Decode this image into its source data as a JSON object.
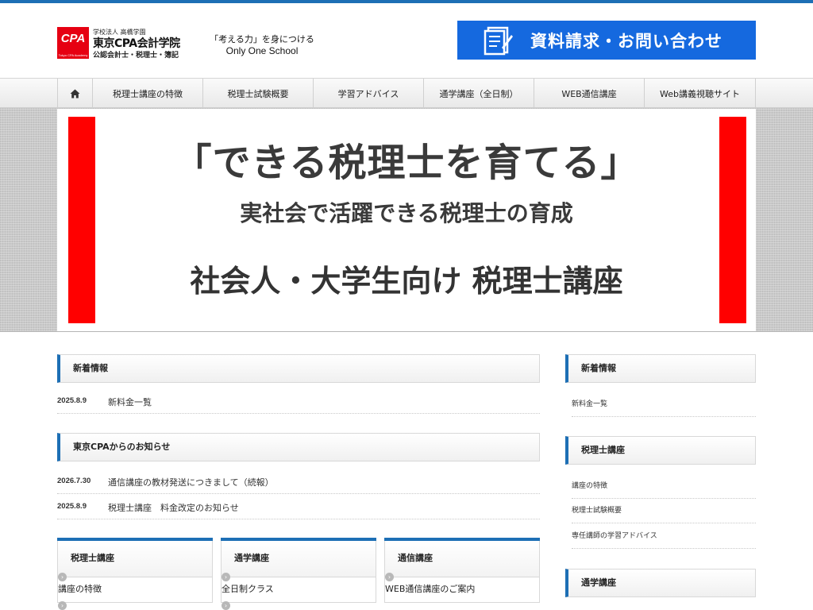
{
  "header": {
    "logo_mark": "CPA",
    "logo_mark_sub": "Tokyo CPA Academy",
    "logo_line1": "学校法人 高橋学園",
    "logo_line2": "東京CPA会計学院",
    "logo_line3": "公認会計士・税理士・簿記",
    "tagline_jp": "「考える力」を身につける",
    "tagline_en": "Only One School",
    "request_button": "資料請求・お問い合わせ"
  },
  "nav": {
    "home_icon": "home-icon",
    "items": [
      "税理士講座の特徴",
      "税理士試験概要",
      "学習アドバイス",
      "通学講座（全日制）",
      "WEB通信講座",
      "Web講義視聴サイト"
    ]
  },
  "hero": {
    "headline": "「できる税理士を育てる」",
    "subheadline": "実社会で活躍できる税理士の育成",
    "tagline": "社会人・大学生向け 税理士講座"
  },
  "main": {
    "news_heading": "新着情報",
    "news": [
      {
        "date": "2025.8.9",
        "title": "新料金一覧"
      }
    ],
    "notices_heading": "東京CPAからのお知らせ",
    "notices": [
      {
        "date": "2026.7.30",
        "title": "通信講座の教材発送につきまして（続報）"
      },
      {
        "date": "2025.8.9",
        "title": "税理士講座　料金改定のお知らせ"
      }
    ],
    "cards": [
      {
        "title": "税理士講座",
        "link": "講座の特徴"
      },
      {
        "title": "通学講座",
        "link": "全日制クラス"
      },
      {
        "title": "通信講座",
        "link": "WEB通信講座のご案内"
      }
    ]
  },
  "sidebar": {
    "news_heading": "新着情報",
    "news_links": [
      "新料金一覧"
    ],
    "course_heading": "税理士講座",
    "course_links": [
      "講座の特徴",
      "税理士試験概要",
      "専任講師の学習アドバイス"
    ],
    "commute_heading": "通学講座"
  },
  "colors": {
    "accent_blue": "#1d6fb5",
    "button_blue": "#1569df",
    "hero_red": "#ff0000",
    "logo_red": "#e60012"
  }
}
